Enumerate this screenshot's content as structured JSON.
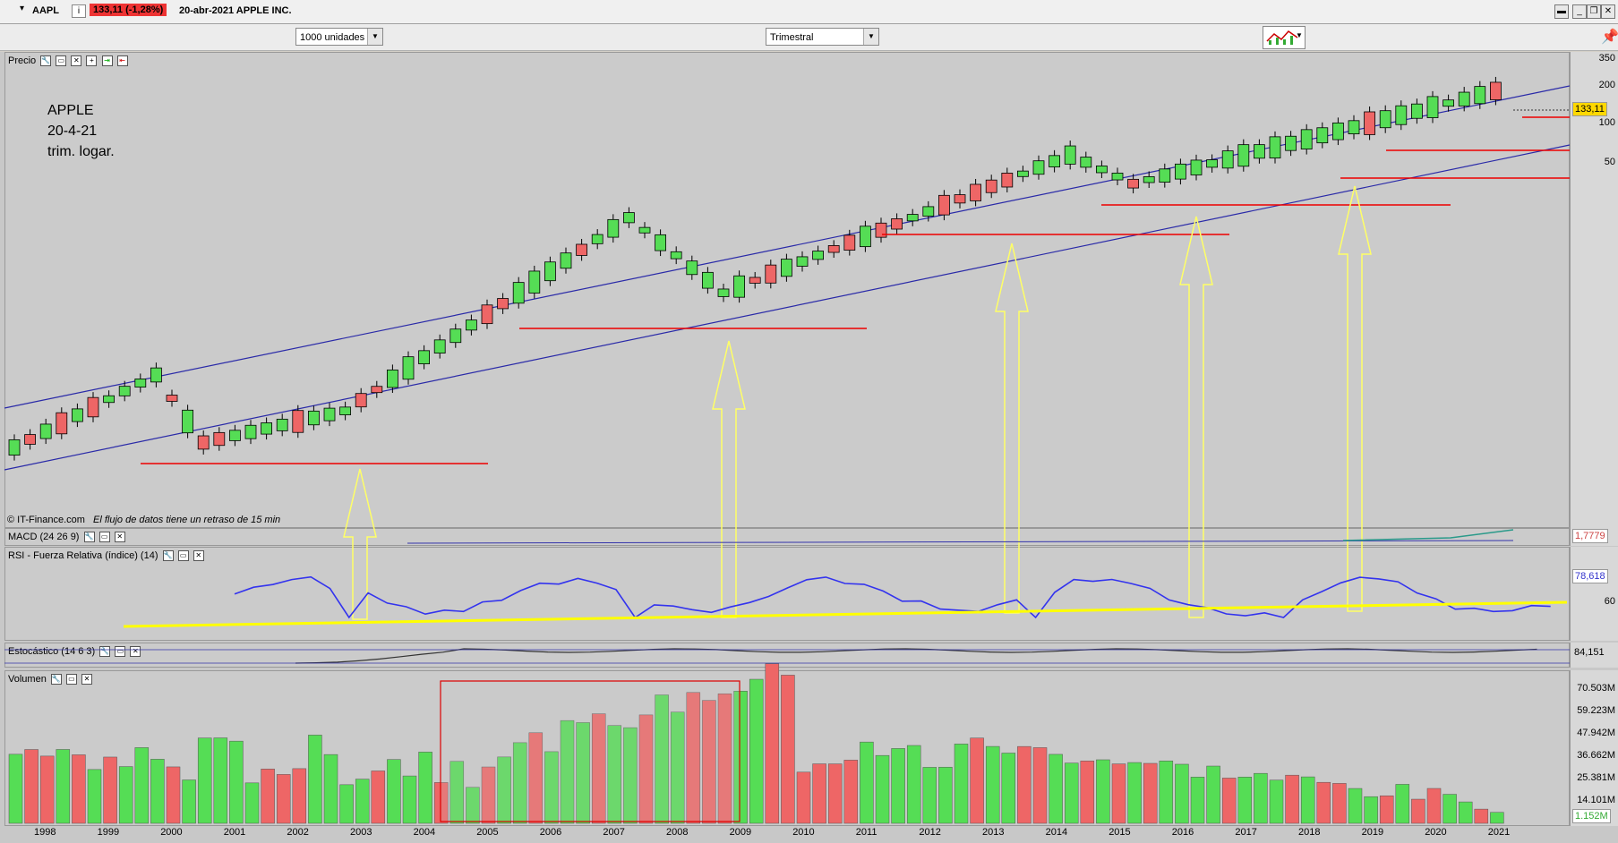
{
  "header": {
    "symbol": "AAPL",
    "info_icon": "i",
    "price_change": "133,11 (-1,28%)",
    "description": "20-abr-2021 APPLE INC."
  },
  "toolbar": {
    "units_select": "1000 unidades",
    "period_select": "Trimestral"
  },
  "annotation": {
    "line1": "APPLE",
    "line2": "20-4-21",
    "line3": "trim. logar."
  },
  "price_panel": {
    "title": "Precio",
    "y_labels": [
      "350",
      "200",
      "100",
      "50"
    ],
    "last_price_tag": "133,11",
    "watermark_source": "© IT-Finance.com",
    "watermark_note": "El flujo de datos tiene un retraso de 15 min"
  },
  "macd_panel": {
    "title": "MACD (24 26 9)",
    "value_tag": "1,7779"
  },
  "rsi_panel": {
    "title": "RSI - Fuerza Relativa (índice) (14)",
    "value_tag": "78,618",
    "level_label": "60"
  },
  "stoch_panel": {
    "title": "Estocástico (14 6 3)",
    "value_tag": "84,151"
  },
  "volume_panel": {
    "title": "Volumen",
    "y_labels": [
      "70.503M",
      "59.223M",
      "47.942M",
      "36.662M",
      "25.381M",
      "14.101M"
    ],
    "value_tag": "1.152M"
  },
  "x_axis": [
    "1998",
    "1999",
    "2000",
    "2001",
    "2002",
    "2003",
    "2004",
    "2005",
    "2006",
    "2007",
    "2008",
    "2009",
    "2010",
    "2011",
    "2012",
    "2013",
    "2014",
    "2015",
    "2016",
    "2017",
    "2018",
    "2019",
    "2020",
    "2021"
  ],
  "colors": {
    "up": "#55dd55",
    "down": "#ee6666",
    "channel": "#2a2aa8",
    "support": "#ee0000",
    "arrow": "#ffff66",
    "rsi": "#3333ee"
  }
}
